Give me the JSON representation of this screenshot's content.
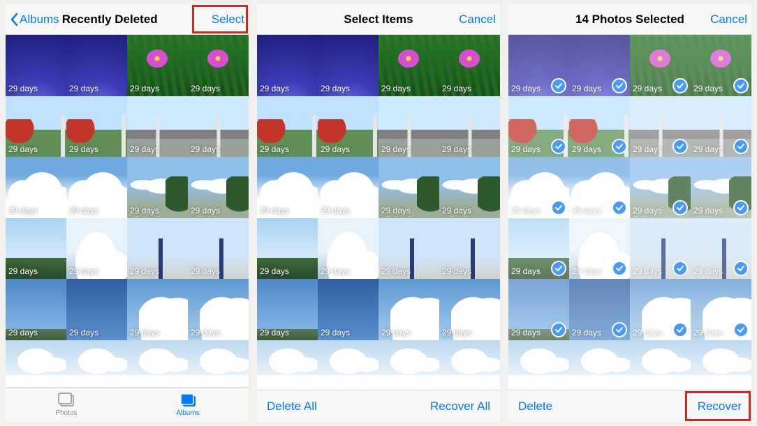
{
  "colors": {
    "accent": "#007aff",
    "highlight": "#d4281f"
  },
  "panes": [
    {
      "nav": {
        "back_label": "Albums",
        "title": "Recently Deleted",
        "right_label": "Select",
        "right_highlight": true
      },
      "tabbar": {
        "photos_label": "Photos",
        "albums_label": "Albums",
        "active": "albums"
      }
    },
    {
      "nav": {
        "title": "Select Items",
        "right_label": "Cancel"
      },
      "toolbar": {
        "left_label": "Delete All",
        "right_label": "Recover All"
      }
    },
    {
      "nav": {
        "title": "14 Photos Selected",
        "right_label": "Cancel"
      },
      "toolbar": {
        "left_label": "Delete",
        "right_label": "Recover",
        "right_highlight": true
      }
    }
  ],
  "thumb_label": "29 days",
  "thumb_art_rows": [
    [
      "startrails",
      "startrails",
      "flower",
      "flower"
    ],
    [
      "skytree-red",
      "skytree-red",
      "skyroad",
      "skyroad"
    ],
    [
      "clouds1",
      "clouds1",
      "cloudstree",
      "cloudstree"
    ],
    [
      "skytrees",
      "lowclouds",
      "streetpole",
      "streetpole"
    ],
    [
      "bluesky",
      "deepsky",
      "bigcloud",
      "bigcloud"
    ],
    [
      "paleclouds",
      "paleclouds",
      "paleclouds",
      "paleclouds"
    ]
  ],
  "selected_rows": 5
}
